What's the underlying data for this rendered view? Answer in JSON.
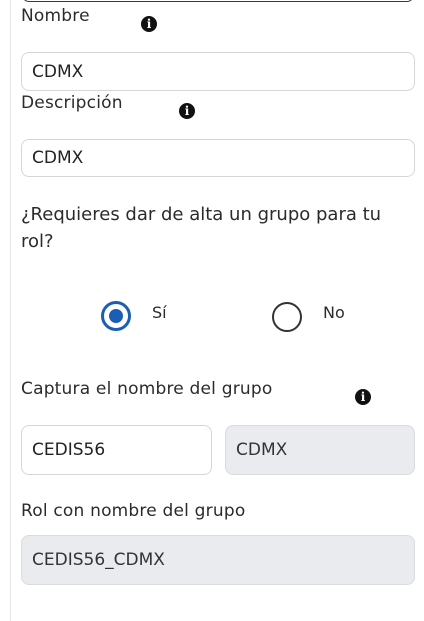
{
  "form": {
    "nombre": {
      "label": "Nombre",
      "value": "CDMX"
    },
    "descripcion": {
      "label": "Descripción",
      "value": "CDMX"
    },
    "group_question": "¿Requieres dar de alta un grupo para tu rol?",
    "radio_options": [
      {
        "label": "Sí",
        "selected": true
      },
      {
        "label": "No",
        "selected": false
      }
    ],
    "captura": {
      "label": "Captura el nombre del grupo",
      "value": "CEDIS56",
      "suffix": "CDMX"
    },
    "rol": {
      "label": "Rol con nombre del grupo",
      "value": "CEDIS56_CDMX"
    },
    "info_glyph": "i"
  },
  "colors": {
    "accent": "#1a5fb4",
    "disabled_bg": "#e9ebee"
  }
}
